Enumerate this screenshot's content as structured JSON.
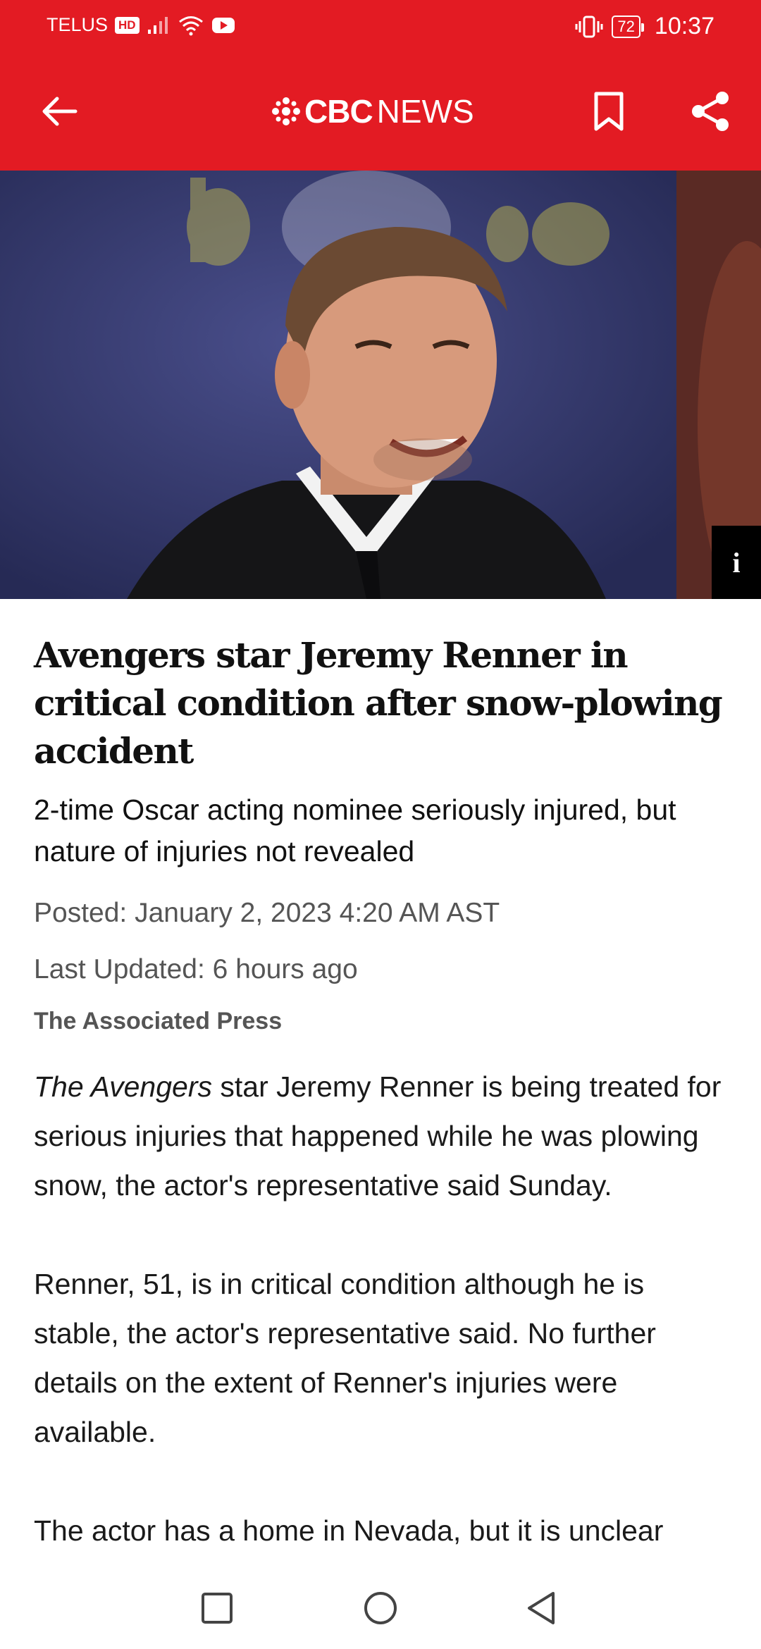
{
  "status_bar": {
    "carrier": "TELUS",
    "network_badge": "HD",
    "battery": "72",
    "time": "10:37",
    "icons": [
      "signal-icon",
      "wifi-icon",
      "youtube-icon",
      "vibrate-icon",
      "battery-icon"
    ]
  },
  "app_bar": {
    "logo_cbc": "CBC",
    "logo_news": "NEWS",
    "icons": [
      "back-arrow-icon",
      "cbc-gem-icon",
      "bookmark-icon",
      "share-icon"
    ]
  },
  "hero": {
    "info_button_label": "i"
  },
  "article": {
    "headline": "Avengers star Jeremy Renner in critical condition after snow-plowing accident",
    "subheadline": "2-time Oscar acting nominee seriously injured, but nature of injuries not revealed",
    "posted": "Posted: January 2, 2023 4:20 AM AST",
    "last_updated": "Last Updated: 6 hours ago",
    "byline": "The Associated Press",
    "paragraphs": [
      {
        "italic_lead": "The Avengers",
        "text": " star Jeremy Renner is being treated for serious injuries that happened while he was plowing snow, the actor's representative said Sunday."
      },
      {
        "text": "Renner, 51, is in critical condition although he is stable, the actor's representative said. No further details on the extent of Renner's injuries were available."
      },
      {
        "text": "The actor has a home in Nevada, but it is unclear"
      }
    ]
  },
  "colors": {
    "brand_red": "#e31b23",
    "meta_gray": "#555555"
  },
  "nav_bar": {
    "icons": [
      "recent-apps-icon",
      "home-icon",
      "back-icon"
    ]
  }
}
